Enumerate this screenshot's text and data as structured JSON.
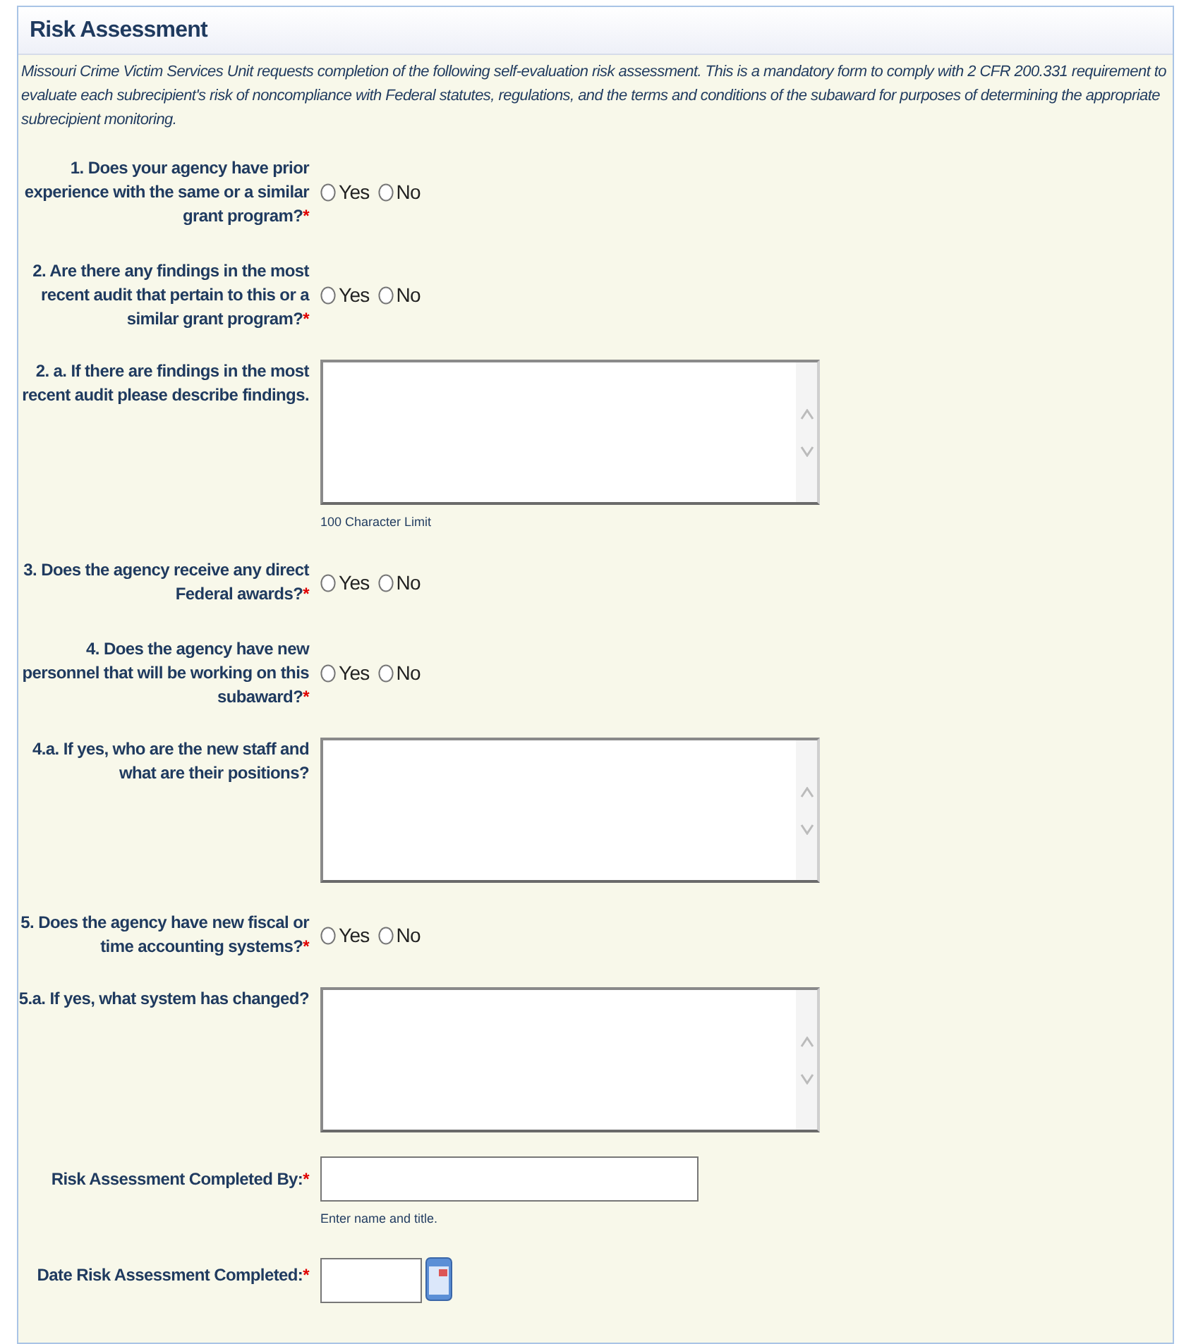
{
  "panel": {
    "title": "Risk Assessment",
    "description": "Missouri Crime Victim Services Unit requests completion of the following self-evaluation risk assessment. This is a mandatory form to comply with 2 CFR 200.331 requirement to evaluate each subrecipient's risk of noncompliance with Federal statutes, regulations, and the terms and conditions of the subaward for purposes of determining the appropriate subrecipient monitoring."
  },
  "fields": [
    {
      "kind": "radio",
      "label": "1. Does your agency have prior experience with the same or a similar grant program?",
      "required_mark": "*",
      "options": [
        {
          "label": "Yes",
          "selected": false
        },
        {
          "label": "No",
          "selected": false
        }
      ]
    },
    {
      "kind": "radio",
      "label": "2. Are there any findings in the most recent audit that pertain to this or a similar grant program?",
      "required_mark": "*",
      "options": [
        {
          "label": "Yes",
          "selected": false
        },
        {
          "label": "No",
          "selected": false
        }
      ]
    },
    {
      "kind": "textarea",
      "label": "2. a. If there are findings in the most recent audit please describe findings.",
      "hint": "100 Character Limit"
    },
    {
      "kind": "radio",
      "label": "3. Does the agency receive any direct Federal awards?",
      "required_mark": "*",
      "options": [
        {
          "label": "Yes",
          "selected": false
        },
        {
          "label": "No",
          "selected": false
        }
      ]
    },
    {
      "kind": "radio",
      "label": "4. Does the agency have new personnel that will be working on this subaward?",
      "required_mark": "*",
      "options": [
        {
          "label": "Yes",
          "selected": false
        },
        {
          "label": "No",
          "selected": false
        }
      ]
    },
    {
      "kind": "textarea",
      "label": "4.a. If yes, who are the new staff and what are their positions?"
    },
    {
      "kind": "radio",
      "label": "5. Does the agency have new fiscal or time accounting systems?",
      "required_mark": "*",
      "options": [
        {
          "label": "Yes",
          "selected": false
        },
        {
          "label": "No",
          "selected": false
        }
      ]
    },
    {
      "kind": "textarea",
      "label": "5.a. If yes, what system has changed?"
    },
    {
      "kind": "text",
      "label": "Risk Assessment Completed By:",
      "required_mark": "*",
      "hint": "Enter name and title."
    },
    {
      "kind": "date",
      "label": "Date Risk Assessment Completed:",
      "required_mark": "*"
    }
  ]
}
